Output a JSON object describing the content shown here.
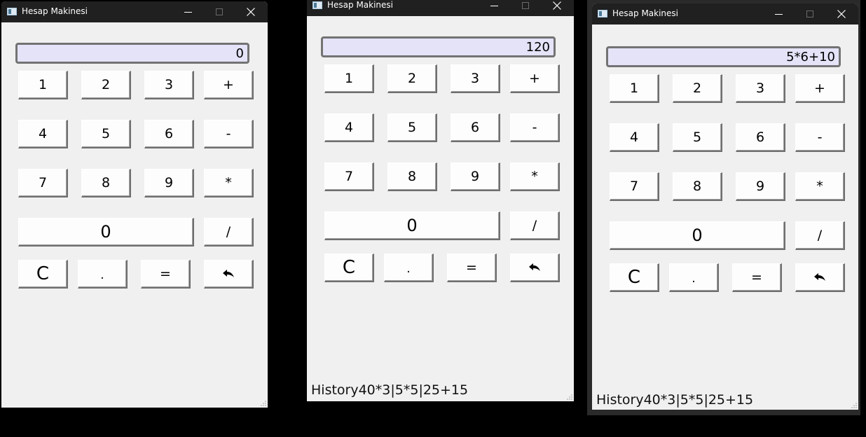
{
  "windows": [
    {
      "title": "Hesap Makinesi",
      "display": "0",
      "history": ""
    },
    {
      "title": "Hesap Makinesi",
      "display": "120",
      "history": "History40*3|5*5|25+15"
    },
    {
      "title": "Hesap Makinesi",
      "display": "5*6+10",
      "history": "History40*3|5*5|25+15"
    }
  ],
  "keys": {
    "one": "1",
    "two": "2",
    "three": "3",
    "plus": "+",
    "four": "4",
    "five": "5",
    "six": "6",
    "minus": "-",
    "seven": "7",
    "eight": "8",
    "nine": "9",
    "multiply": "*",
    "zero": "0",
    "divide": "/",
    "clear": "C",
    "dot": ".",
    "equals": "="
  },
  "icons": {
    "window_controls": [
      "minimize-icon",
      "maximize-icon",
      "close-icon"
    ],
    "backspace": "undo-arrow-icon"
  },
  "colors": {
    "titlebar": "#202020",
    "window_bg": "#f0f0f0",
    "display_bg": "#e4e3f8",
    "display_border": "#737373",
    "button_bg": "#fdfdfd"
  }
}
